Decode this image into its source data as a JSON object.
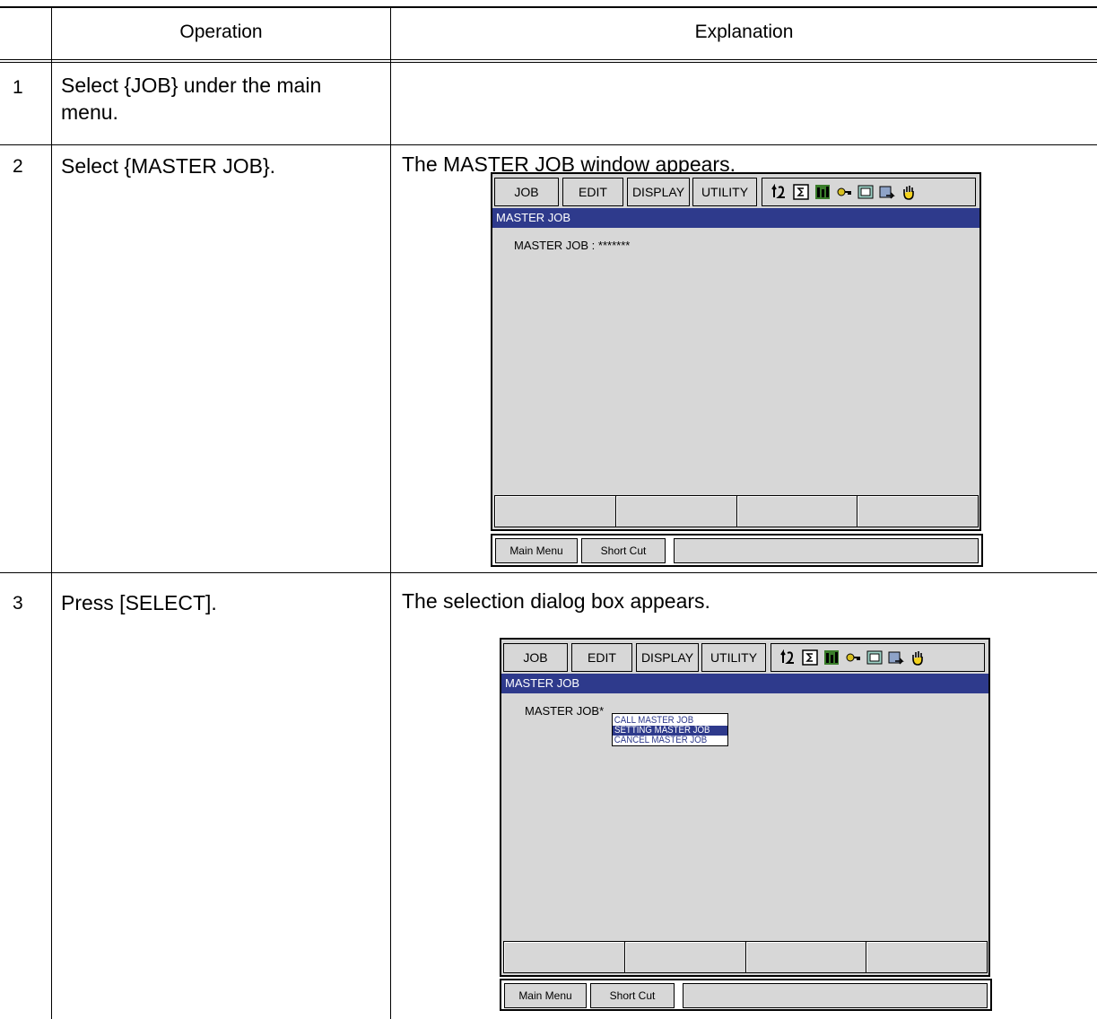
{
  "table": {
    "headers": {
      "operation": "Operation",
      "explanation": "Explanation"
    },
    "steps": [
      {
        "number": "1",
        "operation": "Select {JOB} under the main menu.",
        "explanation": ""
      },
      {
        "number": "2",
        "operation": "Select {MASTER JOB}.",
        "explanation": "The MASTER JOB window appears."
      },
      {
        "number": "3",
        "operation": "Press [SELECT].",
        "explanation": "The selection dialog box appears."
      }
    ]
  },
  "screen1": {
    "menu": {
      "job": "JOB",
      "edit": "EDIT",
      "display": "DISPLAY",
      "utility": "UTILITY"
    },
    "title": "MASTER JOB",
    "field_text": "MASTER JOB : *******",
    "bottom": {
      "main_menu": "Main Menu",
      "short_cut": "Short Cut"
    }
  },
  "screen2": {
    "menu": {
      "job": "JOB",
      "edit": "EDIT",
      "display": "DISPLAY",
      "utility": "UTILITY"
    },
    "title": "MASTER JOB",
    "field_text": "MASTER JOB*",
    "popup": {
      "items": [
        "CALL MASTER JOB",
        "SETTING MASTER JOB",
        "CANCEL MASTER JOB"
      ],
      "selected_index": 1
    },
    "bottom": {
      "main_menu": "Main Menu",
      "short_cut": "Short Cut"
    }
  },
  "status_icons": [
    "coordinate-icon",
    "sigma-icon",
    "m1-mode-icon",
    "key-icon",
    "storage-icon",
    "output-icon",
    "hand-icon"
  ],
  "colors": {
    "title_bar": "#2e3a8c",
    "panel_gray": "#d7d7d7"
  }
}
